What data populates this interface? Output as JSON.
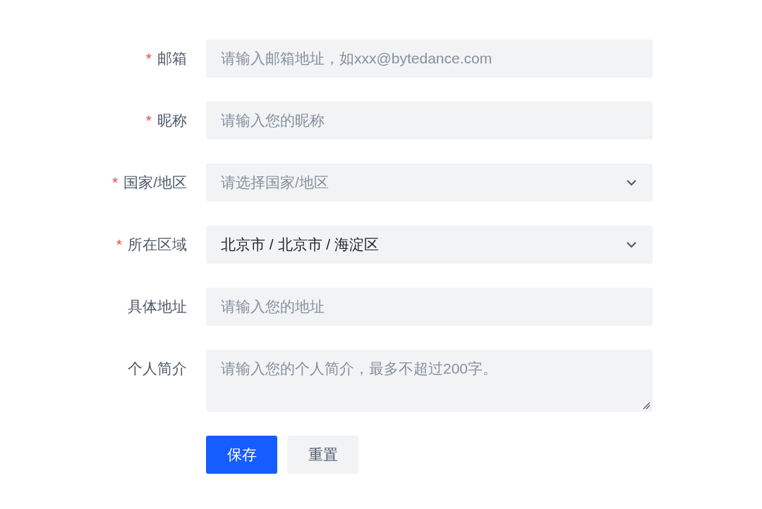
{
  "fields": [
    {
      "label": "邮箱",
      "required_mark": "*",
      "kind": "input",
      "placeholder": "请输入邮箱地址，如xxx@bytedance.com"
    },
    {
      "label": "昵称",
      "required_mark": "*",
      "kind": "input",
      "placeholder": "请输入您的昵称"
    },
    {
      "label": "国家/地区",
      "required_mark": "*",
      "kind": "select",
      "placeholder": "请选择国家/地区"
    },
    {
      "label": "所在区域",
      "required_mark": "*",
      "kind": "select",
      "value": "北京市 / 北京市 / 海淀区"
    },
    {
      "label": "具体地址",
      "kind": "input",
      "placeholder": "请输入您的地址"
    },
    {
      "label": "个人简介",
      "kind": "textarea",
      "placeholder": "请输入您的个人简介，最多不超过200字。"
    }
  ],
  "buttons": [
    {
      "label": "保存",
      "kind": "primary"
    },
    {
      "label": "重置",
      "kind": "secondary"
    }
  ]
}
